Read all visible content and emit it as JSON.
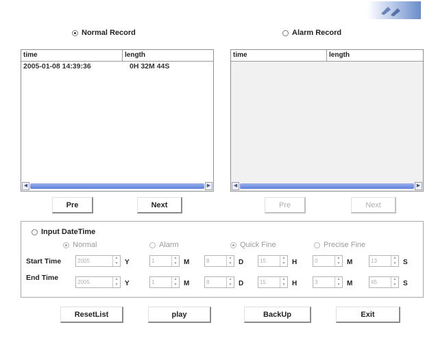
{
  "record_type": {
    "normal_label": "Normal Record",
    "alarm_label": "Alarm Record"
  },
  "normal_list": {
    "columns": [
      "time",
      "length"
    ],
    "rows": [
      [
        "2005-01-08 14:39:36",
        "0H 32M 44S"
      ]
    ]
  },
  "alarm_list": {
    "columns": [
      "time",
      "length"
    ],
    "rows": []
  },
  "paging": {
    "pre_label": "Pre",
    "next_label": "Next"
  },
  "input_datetime": {
    "title": "Input DateTime",
    "modes": [
      "Normal",
      "Alarm",
      "Quick Fine",
      "Precise Fine"
    ],
    "start_label": "Start Time",
    "end_label": "End Time",
    "units": [
      "Y",
      "M",
      "D",
      "H",
      "M",
      "S"
    ],
    "start_values": [
      "2005",
      "1",
      "8",
      "15",
      "0",
      "13"
    ],
    "end_values": [
      "2005",
      "1",
      "8",
      "15",
      "3",
      "45"
    ]
  },
  "actions": {
    "reset_label": "ResetList",
    "play_label": "play",
    "backup_label": "BackUp",
    "exit_label": "Exit"
  }
}
